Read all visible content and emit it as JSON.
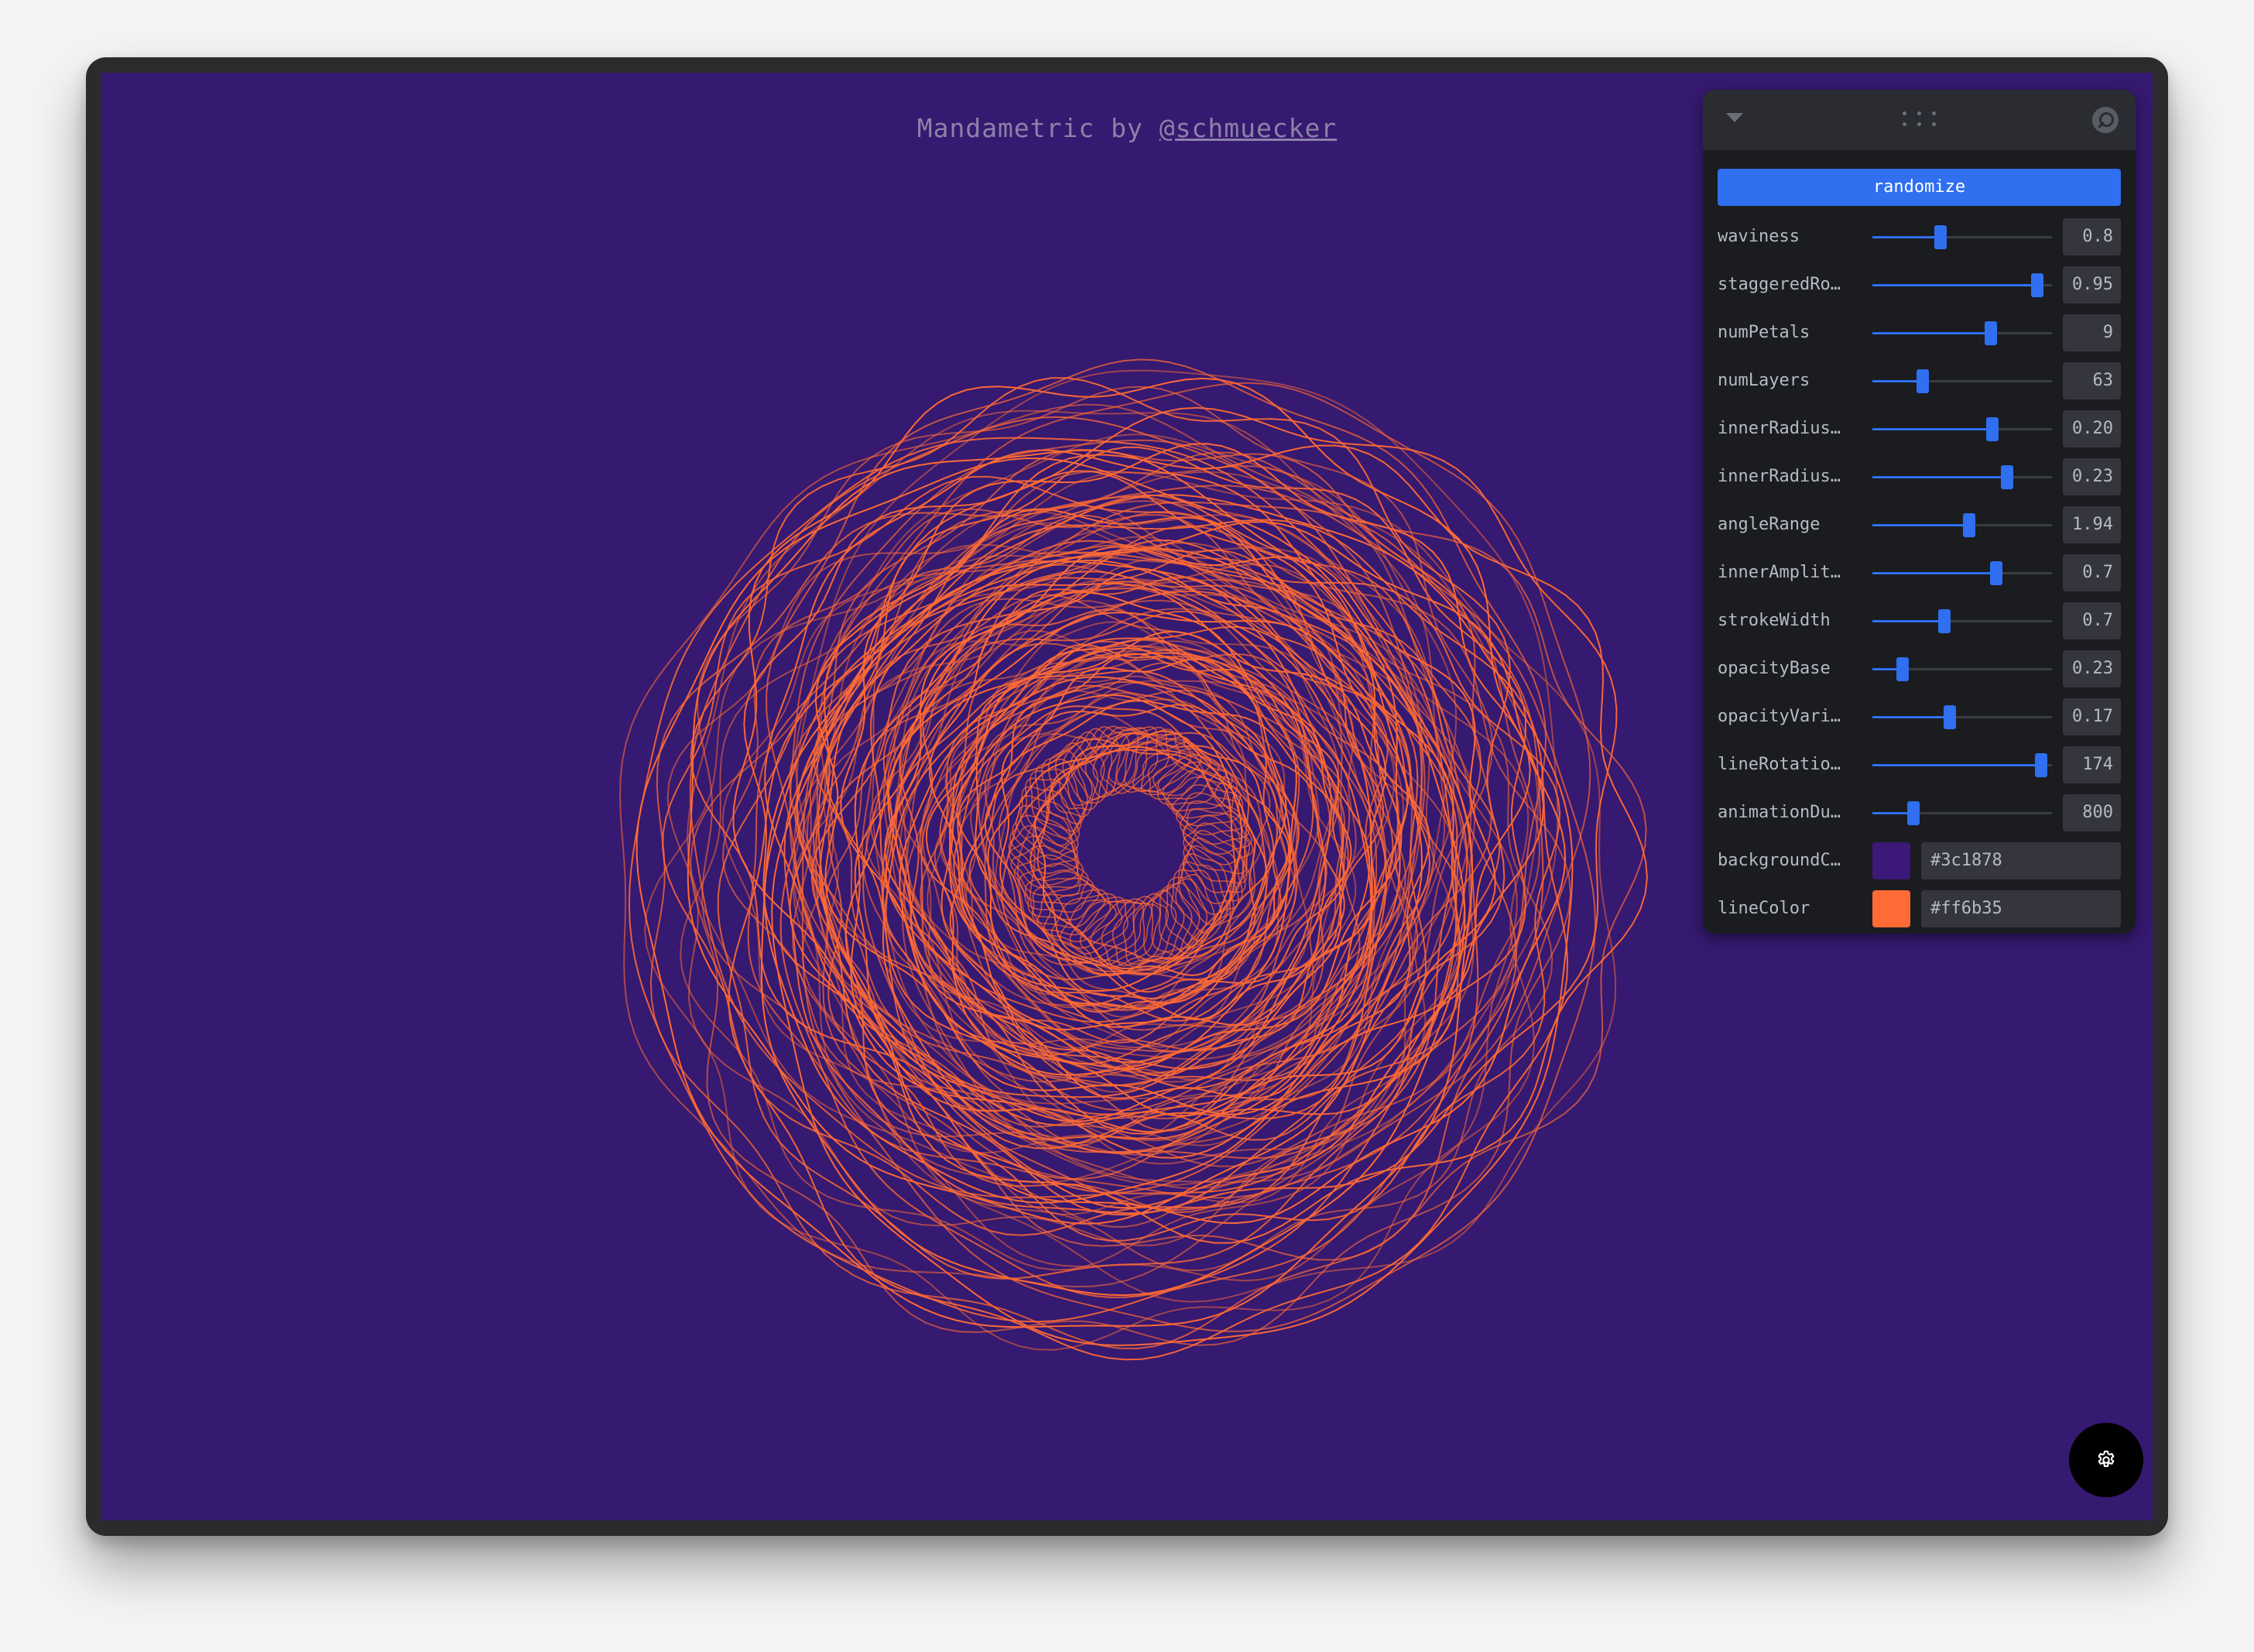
{
  "page": {
    "title_prefix": "Mandametric by ",
    "title_handle": "@schmuecker"
  },
  "colors": {
    "background": "#3c1878",
    "line": "#ff6b35",
    "accent": "#2f6ff0"
  },
  "panel": {
    "header_icons": [
      "chevron-down-icon",
      "drag-handle-icon",
      "search-icon"
    ],
    "randomize_label": "randomize",
    "sliders": [
      {
        "label": "waviness",
        "value": "0.8",
        "fraction": 0.38
      },
      {
        "label": "staggeredRo…",
        "value": "0.95",
        "fraction": 0.92
      },
      {
        "label": "numPetals",
        "value": "9",
        "fraction": 0.66
      },
      {
        "label": "numLayers",
        "value": "63",
        "fraction": 0.28
      },
      {
        "label": "innerRadius…",
        "value": "0.20",
        "fraction": 0.67
      },
      {
        "label": "innerRadius…",
        "value": "0.23",
        "fraction": 0.75
      },
      {
        "label": "angleRange",
        "value": "1.94",
        "fraction": 0.54
      },
      {
        "label": "innerAmplit…",
        "value": "0.7",
        "fraction": 0.69
      },
      {
        "label": "strokeWidth",
        "value": "0.7",
        "fraction": 0.4
      },
      {
        "label": "opacityBase",
        "value": "0.23",
        "fraction": 0.17
      },
      {
        "label": "opacityVari…",
        "value": "0.17",
        "fraction": 0.43
      },
      {
        "label": "lineRotatio…",
        "value": "174",
        "fraction": 0.94
      },
      {
        "label": "animationDu…",
        "value": "800",
        "fraction": 0.23
      }
    ],
    "color_fields": [
      {
        "label": "backgroundC…",
        "value": "#3c1878"
      },
      {
        "label": "lineColor",
        "value": "#ff6b35"
      }
    ]
  },
  "fab": {
    "icon": "gear-icon"
  }
}
